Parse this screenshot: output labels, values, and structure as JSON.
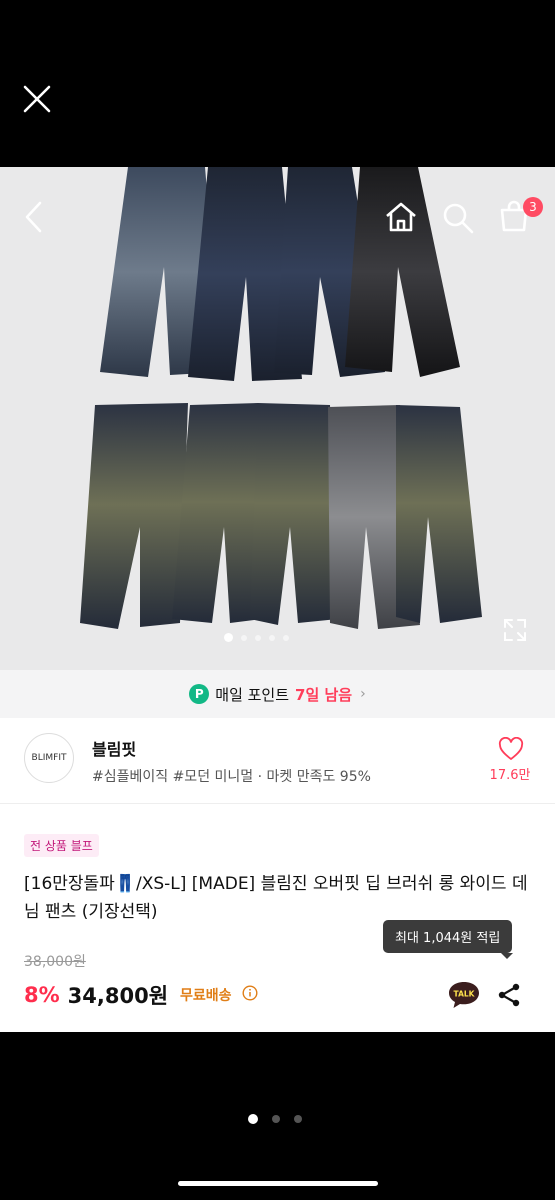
{
  "viewer": {
    "close_icon": "close-icon",
    "pager_count": 3,
    "pager_active": 1
  },
  "header": {
    "cart_count": "3",
    "icons": [
      "back-arrow-icon",
      "home-icon",
      "search-icon",
      "cart-icon"
    ]
  },
  "gallery": {
    "slide_count": 5,
    "active_slide": 1,
    "expand_icon": "expand-icon"
  },
  "points": {
    "badge": "P",
    "prefix": "매일 포인트",
    "highlight": "7일 남음"
  },
  "store": {
    "logo_text": "BLIMFIT",
    "name": "블림핏",
    "tags": "#심플베이직 #모던 미니멀 · 마켓 만족도 95%",
    "likes": "17.6만"
  },
  "product": {
    "sale_tag": "전 상품 블프",
    "title": "[16만장돌파👖/XS-L] [MADE] 블림진 오버핏 딥 브러쉬 롱 와이드 데님 팬츠 (기장선택)",
    "tooltip": "최대 1,044원 적립",
    "original_price": "38,000원",
    "discount": "8%",
    "price": "34,800원",
    "shipping": "무료배송"
  },
  "actions": {
    "talk_label": "TALK"
  },
  "colors": {
    "accent": "#ff3d5a",
    "points_green": "#12b886",
    "shipping_orange": "#e07e17",
    "tag_pink": "#c2187a"
  }
}
